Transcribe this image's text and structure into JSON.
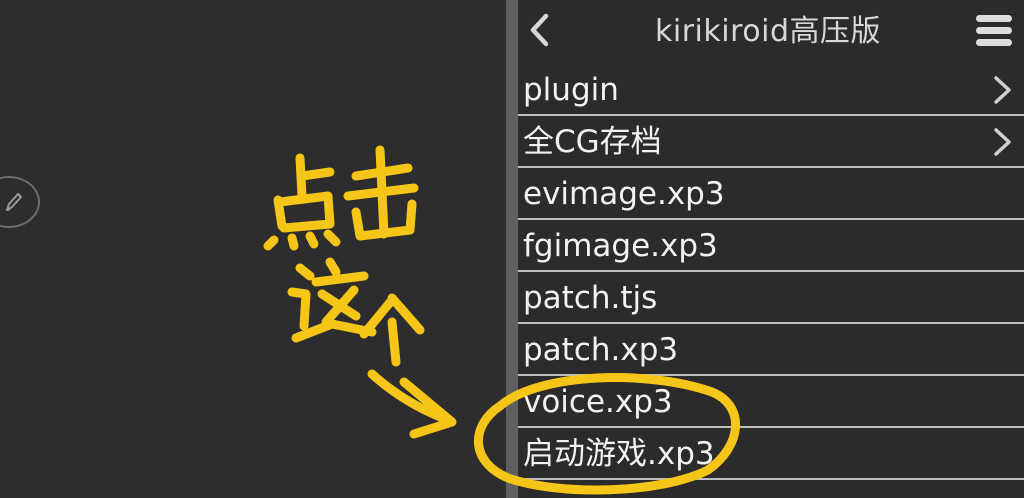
{
  "header": {
    "title": "kirikiroid高压版",
    "back_icon": "chevron-left-icon",
    "menu_icon": "hamburger-menu-icon"
  },
  "file_list": [
    {
      "name": "plugin",
      "type": "folder"
    },
    {
      "name": "全CG存档",
      "type": "folder"
    },
    {
      "name": "evimage.xp3",
      "type": "file"
    },
    {
      "name": "fgimage.xp3",
      "type": "file"
    },
    {
      "name": "patch.tjs",
      "type": "file"
    },
    {
      "name": "patch.xp3",
      "type": "file"
    },
    {
      "name": "voice.xp3",
      "type": "file"
    },
    {
      "name": "启动游戏.xp3",
      "type": "file"
    }
  ],
  "left_panel": {
    "fab_icon": "pencil-icon"
  },
  "annotation": {
    "text": "点击这个",
    "color": "#f5c518",
    "points_to": "启动游戏.xp3"
  },
  "colors": {
    "background": "#2b2b2b",
    "divider": "#5f5f5f",
    "separator": "#bdbdbd",
    "annotation": "#f5c518"
  }
}
